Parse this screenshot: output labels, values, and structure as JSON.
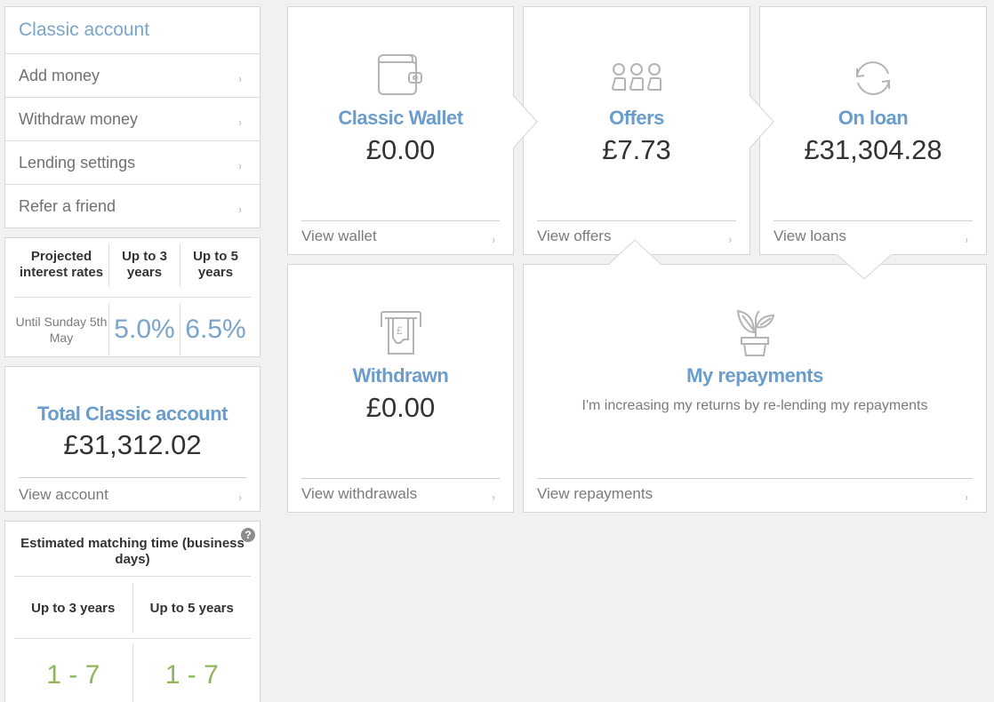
{
  "sidebar": {
    "title": "Classic account",
    "items": [
      {
        "label": "Add money"
      },
      {
        "label": "Withdraw money"
      },
      {
        "label": "Lending settings"
      },
      {
        "label": "Refer a friend"
      }
    ],
    "chevron": "›"
  },
  "rates": {
    "header": [
      "Projected interest rates",
      "Up to 3 years",
      "Up to 5 years"
    ],
    "period": "Until Sunday 5th May",
    "values": [
      "5.0%",
      "6.5%"
    ]
  },
  "total": {
    "title": "Total Classic account",
    "value": "£31,312.02",
    "link": "View account"
  },
  "matching": {
    "title": "Estimated matching time (business days)",
    "help_icon": "?",
    "columns": [
      "Up to 3 years",
      "Up to 5 years"
    ],
    "values": [
      "1 - 7",
      "1 - 7"
    ]
  },
  "tiles": {
    "wallet": {
      "icon": "wallet-icon",
      "title": "Classic Wallet",
      "value": "£0.00",
      "link": "View wallet"
    },
    "offers": {
      "icon": "people-icon",
      "title": "Offers",
      "value": "£7.73",
      "link": "View offers"
    },
    "loan": {
      "icon": "refresh-icon",
      "title": "On loan",
      "value": "£31,304.28",
      "link": "View loans"
    },
    "withdrawn": {
      "icon": "atm-cash-icon",
      "title": "Withdrawn",
      "value": "£0.00",
      "link": "View withdrawals"
    },
    "repayments": {
      "icon": "plant-icon",
      "title": "My repayments",
      "subtitle": "I'm increasing my returns by re-lending my repayments",
      "link": "View repayments"
    }
  },
  "colors": {
    "accent_blue": "#6a9ccc",
    "success_green": "#8fb45a",
    "background": "#f1f1f1"
  }
}
